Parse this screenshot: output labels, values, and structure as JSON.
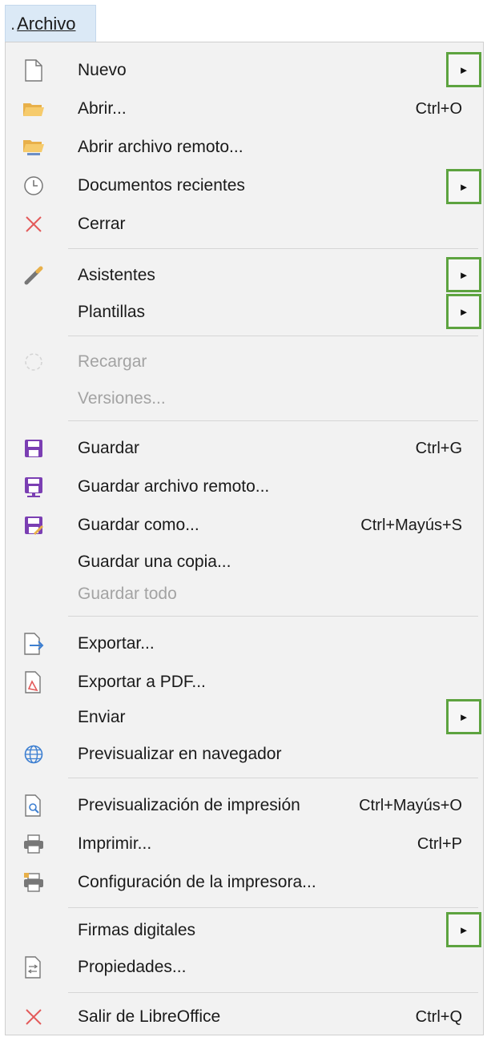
{
  "menubar": {
    "title": "Archivo"
  },
  "items": {
    "nuevo": {
      "label": "Nuevo",
      "shortcut": ""
    },
    "abrir": {
      "label": "Abrir...",
      "shortcut": "Ctrl+O"
    },
    "abrir_remoto": {
      "label": "Abrir archivo remoto...",
      "shortcut": ""
    },
    "recientes": {
      "label": "Documentos recientes",
      "shortcut": ""
    },
    "cerrar": {
      "label": "Cerrar",
      "shortcut": ""
    },
    "asistentes": {
      "label": "Asistentes",
      "shortcut": ""
    },
    "plantillas": {
      "label": "Plantillas",
      "shortcut": ""
    },
    "recargar": {
      "label": "Recargar",
      "shortcut": ""
    },
    "versiones": {
      "label": "Versiones...",
      "shortcut": ""
    },
    "guardar": {
      "label": "Guardar",
      "shortcut": "Ctrl+G"
    },
    "guardar_remoto": {
      "label": "Guardar archivo remoto...",
      "shortcut": ""
    },
    "guardar_como": {
      "label": "Guardar como...",
      "shortcut": "Ctrl+Mayús+S"
    },
    "guardar_copia": {
      "label": "Guardar una copia...",
      "shortcut": ""
    },
    "guardar_todo": {
      "label": "Guardar todo",
      "shortcut": ""
    },
    "exportar": {
      "label": "Exportar...",
      "shortcut": ""
    },
    "exportar_pdf": {
      "label": "Exportar a PDF...",
      "shortcut": ""
    },
    "enviar": {
      "label": "Enviar",
      "shortcut": ""
    },
    "previsualizar_nav": {
      "label": "Previsualizar en navegador",
      "shortcut": ""
    },
    "previsualizacion_imp": {
      "label": "Previsualización de impresión",
      "shortcut": "Ctrl+Mayús+O"
    },
    "imprimir": {
      "label": "Imprimir...",
      "shortcut": "Ctrl+P"
    },
    "config_impresora": {
      "label": "Configuración de la impresora...",
      "shortcut": ""
    },
    "firmas": {
      "label": "Firmas digitales",
      "shortcut": ""
    },
    "propiedades": {
      "label": "Propiedades...",
      "shortcut": ""
    },
    "salir": {
      "label": "Salir de LibreOffice",
      "shortcut": "Ctrl+Q"
    }
  },
  "submenu_arrow": "►",
  "colors": {
    "highlight_border": "#5da33f",
    "save_icon": "#7b3fb3",
    "close_icon": "#e35a5a",
    "disabled_text": "#a3a3a3"
  }
}
